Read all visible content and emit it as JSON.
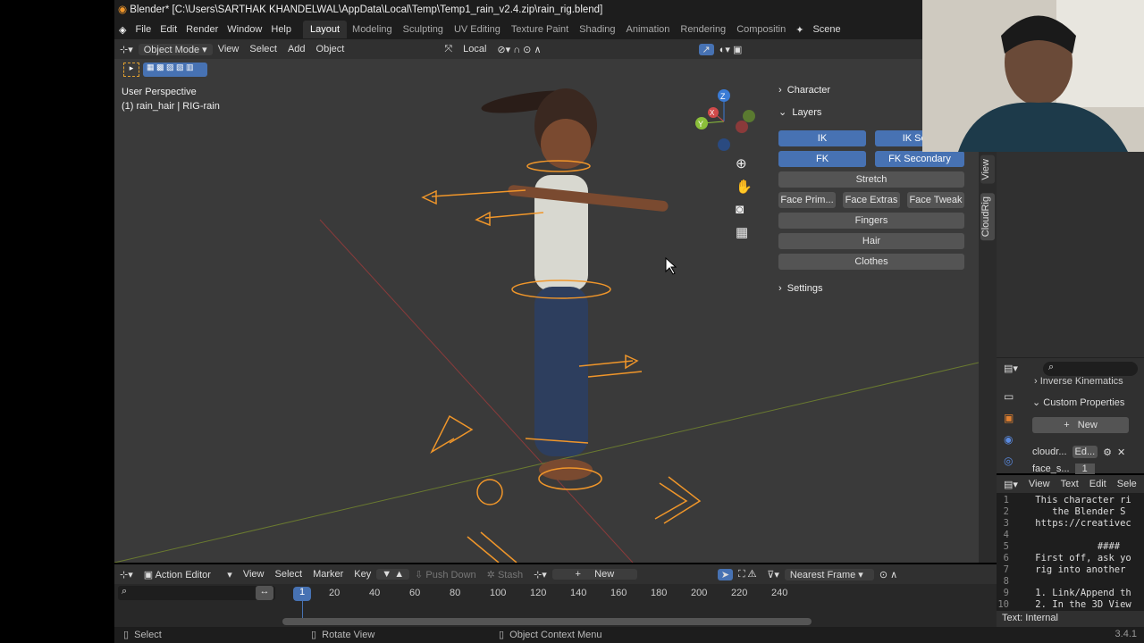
{
  "title": "Blender* [C:\\Users\\SARTHAK KHANDELWAL\\AppData\\Local\\Temp\\Temp1_rain_v2.4.zip\\rain_rig.blend]",
  "menu": [
    "File",
    "Edit",
    "Render",
    "Window",
    "Help"
  ],
  "workspaces": [
    "Layout",
    "Modeling",
    "Sculpting",
    "UV Editing",
    "Texture Paint",
    "Shading",
    "Animation",
    "Rendering",
    "Compositin"
  ],
  "scene": "Scene",
  "header": {
    "mode": "Object Mode",
    "menus": [
      "View",
      "Select",
      "Add",
      "Object"
    ],
    "pivot": "Local"
  },
  "viewport": {
    "perspective": "User Perspective",
    "object": "(1) rain_hair | RIG-rain",
    "gizmo": {
      "z": "Z",
      "y": "Y",
      "x": "X"
    }
  },
  "npanel": {
    "character": "Character",
    "layers": "Layers",
    "buttons": [
      {
        "label": "IK",
        "active": true
      },
      {
        "label": "IK Seco",
        "active": true
      },
      {
        "label": "FK",
        "active": true
      },
      {
        "label": "FK Secondary",
        "active": true
      },
      {
        "label": "Stretch"
      },
      {
        "label": "Face Prim..."
      },
      {
        "label": "Face Extras"
      },
      {
        "label": "Face Tweak"
      },
      {
        "label": "Fingers"
      },
      {
        "label": "Hair"
      },
      {
        "label": "Clothes"
      }
    ],
    "settings": "Settings"
  },
  "side_tabs": [
    "View",
    "CloudRig"
  ],
  "props": {
    "ik": "Inverse Kinematics",
    "custom": "Custom Properties",
    "new": "New",
    "rows": [
      {
        "name": "cloudr...",
        "value": "Ed..."
      },
      {
        "name": "face_s...",
        "value": "1"
      }
    ]
  },
  "text_editor": {
    "menus": [
      "View",
      "Text",
      "Edit",
      "Sele"
    ],
    "lines": [
      "    This character ri",
      "       the Blender S",
      "    https://creativec",
      "",
      "               ####",
      "    First off, ask yo",
      "    rig into another",
      "",
      "    1. Link/Append th",
      "    2. In the 3D View"
    ],
    "footer": "Text: Internal"
  },
  "timeline": {
    "editor": "Action Editor",
    "menus": [
      "View",
      "Select",
      "Marker",
      "Key"
    ],
    "push_down": "Push Down",
    "stash": "Stash",
    "new": "New",
    "snap": "Nearest Frame",
    "current_frame": "1",
    "ticks": [
      "20",
      "40",
      "60",
      "80",
      "100",
      "120",
      "140",
      "160",
      "180",
      "200",
      "220",
      "240"
    ]
  },
  "status": {
    "select": "Select",
    "rotate": "Rotate View",
    "context": "Object Context Menu",
    "version": "3.4.1"
  },
  "colors": {
    "accent": "#4772b3",
    "rig": "#f0962a"
  }
}
